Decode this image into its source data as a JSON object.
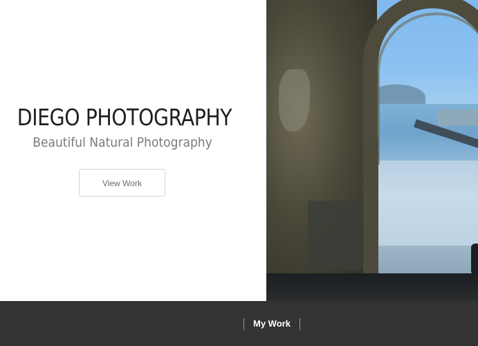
{
  "hero": {
    "title": "DIEGO PHOTOGRAPHY",
    "subtitle": "Beautiful Natural Photography",
    "cta_label": "View Work"
  },
  "footer": {
    "nav_items": [
      {
        "label": "My Work"
      }
    ]
  },
  "colors": {
    "footer_background": "#333333",
    "title_text": "#1e1e1e",
    "subtitle_text": "#7b7b7b",
    "button_border": "#d4d4d4"
  }
}
